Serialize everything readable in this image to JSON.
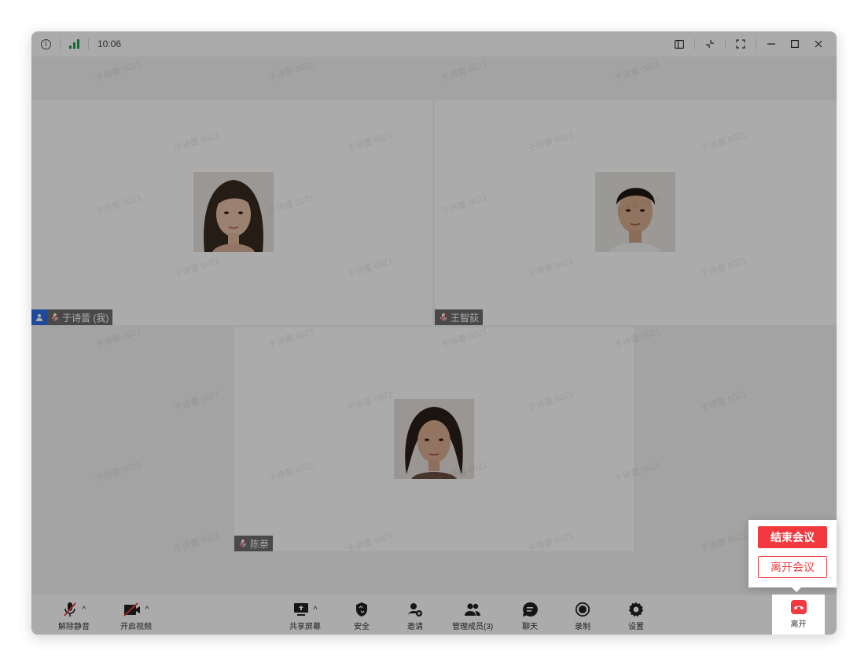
{
  "titlebar": {
    "time": "10:06",
    "info_icon": "info-icon",
    "signal_icon": "signal-icon",
    "buttons": [
      "sidebar-toggle-icon",
      "minimize-view-icon",
      "fullscreen-icon",
      "minimize-icon",
      "maximize-icon",
      "close-icon"
    ]
  },
  "participants": [
    {
      "name": "于诗蕾 (我)",
      "is_self": true,
      "muted": true
    },
    {
      "name": "王智荻",
      "is_self": false,
      "muted": true
    },
    {
      "name": "陈萘",
      "is_self": false,
      "muted": true
    }
  ],
  "watermark": "于诗蕾 0021",
  "toolbar": {
    "unmute": "解除静音",
    "start_video": "开启视频",
    "share_screen": "共享屏幕",
    "security": "安全",
    "invite": "邀请",
    "manage_members": "管理成员(3)",
    "chat": "聊天",
    "record": "录制",
    "settings": "设置",
    "leave": "离开"
  },
  "leave_popup": {
    "end_meeting": "结束会议",
    "leave_meeting": "离开会议"
  },
  "colors": {
    "accent_red": "#f2393f",
    "signal_green": "#1ea34a",
    "self_badge_blue": "#2f6fe4"
  }
}
